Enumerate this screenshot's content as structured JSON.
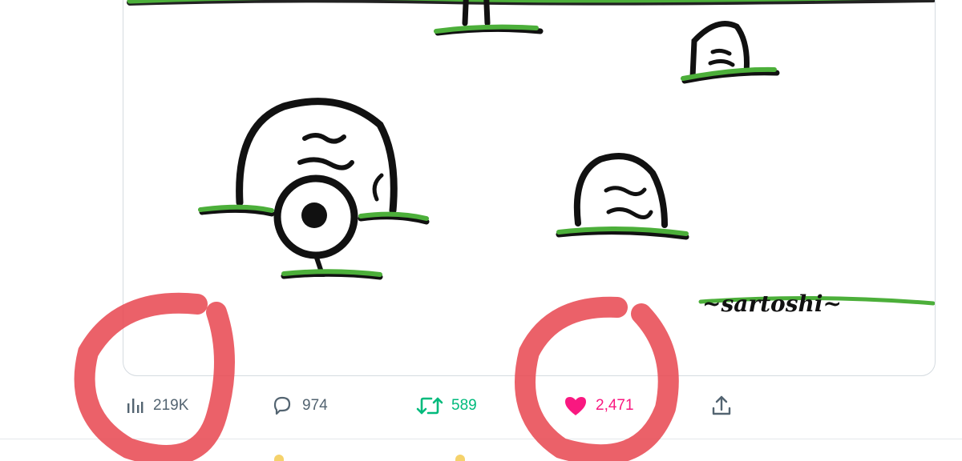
{
  "tweet": {
    "image": {
      "signature_text": "~sartoshi~"
    },
    "actions": {
      "views": {
        "icon": "views-bar-chart-icon",
        "count": "219K"
      },
      "reply": {
        "icon": "reply-bubble-icon",
        "count": "974"
      },
      "retweet": {
        "icon": "retweet-icon",
        "count": "589",
        "color": "#00ba7c"
      },
      "like": {
        "icon": "heart-filled-icon",
        "count": "2,471",
        "color": "#f91880"
      },
      "share": {
        "icon": "share-upload-icon"
      }
    }
  },
  "annotations": {
    "marker_color": "#e8454f",
    "circled": [
      "views",
      "like"
    ]
  }
}
